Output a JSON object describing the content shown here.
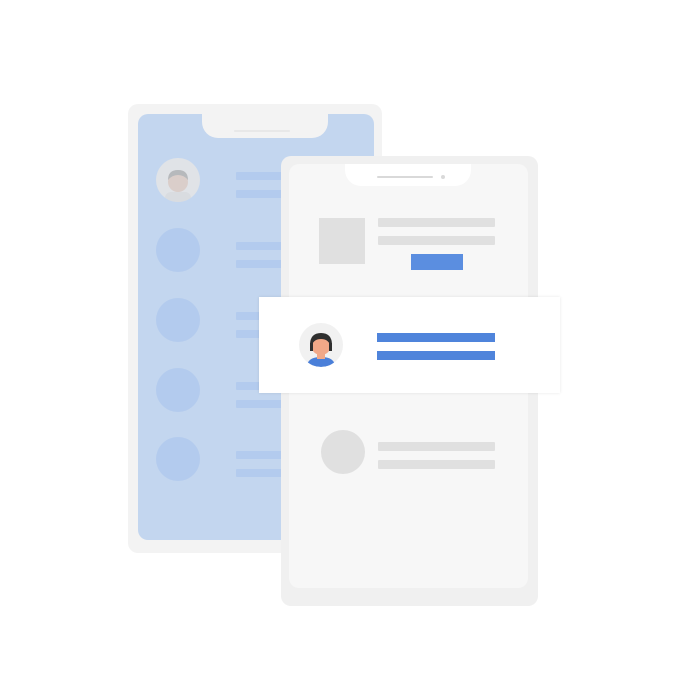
{
  "colors": {
    "accent_blue": "#4f84db",
    "back_screen": "#c3d6ef",
    "back_placeholder": "#b3cbee",
    "front_screen": "#f7f7f7",
    "placeholder_grey": "#e0e0e0",
    "skin": "#f1a888",
    "hair": "#2f2f2f",
    "shirt": "#4a7fd9"
  },
  "back_phone": {
    "rows": [
      {
        "avatar": "avatar-icon",
        "selected": true
      },
      {
        "avatar": "placeholder-circle"
      },
      {
        "avatar": "placeholder-circle"
      },
      {
        "avatar": "placeholder-circle"
      },
      {
        "avatar": "placeholder-circle"
      }
    ]
  },
  "front_phone": {
    "items": [
      "image-placeholder",
      "highlighted-contact-card",
      "circle-placeholder"
    ]
  },
  "popup_card": {
    "avatar_icon": "person-avatar-icon"
  }
}
